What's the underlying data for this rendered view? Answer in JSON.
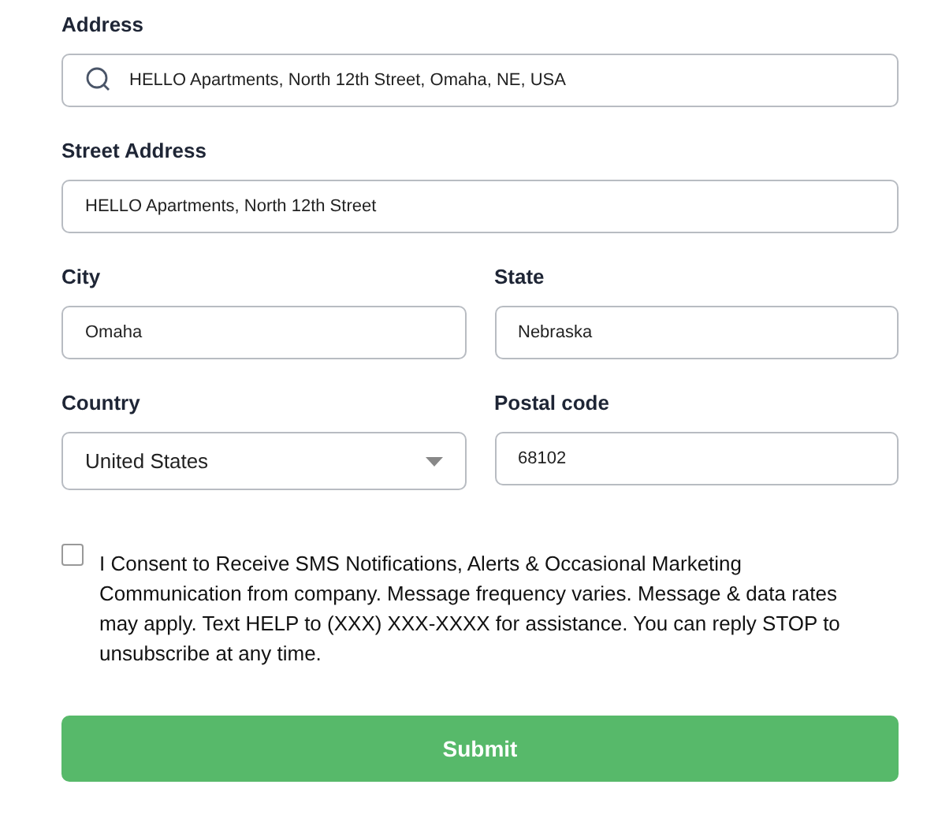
{
  "rows": [
    {
      "fields": [
        {
          "kind": "search",
          "label": "Address",
          "value": "HELLO Apartments, North 12th Street, Omaha, NE, USA"
        }
      ]
    },
    {
      "fields": [
        {
          "kind": "text",
          "label": "Street Address",
          "value": "HELLO Apartments, North 12th Street"
        }
      ]
    },
    {
      "fields": [
        {
          "kind": "text",
          "label": "City",
          "value": "Omaha"
        },
        {
          "kind": "text",
          "label": "State",
          "value": "Nebraska"
        }
      ]
    },
    {
      "fields": [
        {
          "kind": "select",
          "label": "Country",
          "value": "United States"
        },
        {
          "kind": "text",
          "label": "Postal code",
          "value": "68102"
        }
      ]
    }
  ],
  "consent": {
    "checked": false,
    "text": "I Consent to Receive SMS Notifications, Alerts & Occasional Marketing Communication from company. Message frequency varies. Message & data rates may apply. Text HELP to (XXX) XXX-XXXX for assistance. You can reply STOP to unsubscribe at any time."
  },
  "submit": {
    "label": "Submit"
  }
}
